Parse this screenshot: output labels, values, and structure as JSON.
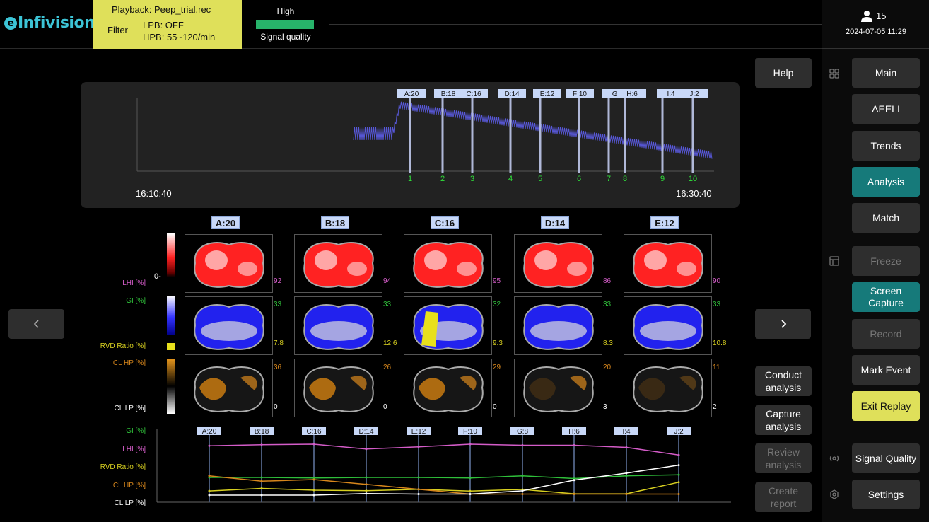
{
  "header": {
    "logo": "Infivision",
    "playback": "Playback:  Peep_trial.rec",
    "filter_label": "Filter",
    "lpb": "LPB: OFF",
    "hpb": "HPB: 55~120/min",
    "signal_level": "High",
    "signal_label": "Signal quality",
    "signal_color": "#27b36a"
  },
  "user": {
    "count": "15",
    "datetime": "2024-07-05 11:29"
  },
  "sidebar": {
    "items": [
      {
        "label": "Main",
        "state": "normal"
      },
      {
        "label": "ΔEELI",
        "state": "normal"
      },
      {
        "label": "Trends",
        "state": "normal"
      },
      {
        "label": "Analysis",
        "state": "active"
      },
      {
        "label": "Match",
        "state": "normal"
      },
      {
        "label": "Freeze",
        "state": "disabled"
      },
      {
        "label": "Screen Capture",
        "state": "active"
      },
      {
        "label": "Record",
        "state": "disabled"
      },
      {
        "label": "Mark Event",
        "state": "normal"
      },
      {
        "label": "Exit Replay",
        "state": "highlight"
      },
      {
        "label": "Signal Quality",
        "state": "normal"
      },
      {
        "label": "Settings",
        "state": "normal"
      }
    ]
  },
  "actions": {
    "help": "Help",
    "conduct": "Conduct analysis",
    "capture": "Capture analysis",
    "review": "Review analysis",
    "create": "Create report"
  },
  "timeline": {
    "start": "16:10:40",
    "end": "16:30:40",
    "markers": [
      {
        "label": "A:20",
        "num": "1"
      },
      {
        "label": "B:18",
        "num": "2"
      },
      {
        "label": "C:16",
        "num": "3"
      },
      {
        "label": "D:14",
        "num": "4"
      },
      {
        "label": "E:12",
        "num": "5"
      },
      {
        "label": "F:10",
        "num": "6"
      },
      {
        "label": "G:",
        "num": "7"
      },
      {
        "label": "H:6",
        "num": "8"
      },
      {
        "label": "I:4",
        "num": "9"
      },
      {
        "label": "J:2",
        "num": "10"
      }
    ]
  },
  "maps": {
    "row_labels": {
      "lhi": "LHI  [%]",
      "gi": "GI   [%]",
      "rvd": "RVD Ratio [%]",
      "clhp": "CL HP [%]",
      "cllp": "CL LP [%]",
      "zero": "0-"
    },
    "columns": [
      {
        "label": "A:20",
        "lhi": "92",
        "gi": "33",
        "rvd": "7.8",
        "clhp": "36",
        "cllp": "0"
      },
      {
        "label": "B:18",
        "lhi": "94",
        "gi": "33",
        "rvd": "12.6",
        "clhp": "26",
        "cllp": "0"
      },
      {
        "label": "C:16",
        "lhi": "95",
        "gi": "32",
        "rvd": "9.3",
        "clhp": "29",
        "cllp": "0"
      },
      {
        "label": "D:14",
        "lhi": "86",
        "gi": "33",
        "rvd": "8.3",
        "clhp": "20",
        "cllp": "3"
      },
      {
        "label": "E:12",
        "lhi": "90",
        "gi": "33",
        "rvd": "10.8",
        "clhp": "11",
        "cllp": "2"
      }
    ]
  },
  "chart_data": {
    "type": "line",
    "categories": [
      "A:20",
      "B:18",
      "C:16",
      "D:14",
      "E:12",
      "F:10",
      "G:8",
      "H:6",
      "I:4",
      "J:2"
    ],
    "series": [
      {
        "name": "GI   [%]",
        "color": "#2fbf3a",
        "values": [
          33,
          33,
          32,
          33,
          33,
          32,
          36,
          31,
          36,
          38
        ]
      },
      {
        "name": "LHI  [%]",
        "color": "#d45cc8",
        "values": [
          92,
          94,
          95,
          86,
          90,
          95,
          93,
          93,
          89,
          75
        ]
      },
      {
        "name": "RVD Ratio [%]",
        "color": "#d8d020",
        "values": [
          7.8,
          12.6,
          9.3,
          8.3,
          10.8,
          7.5,
          10.5,
          2.5,
          2.5,
          24
        ]
      },
      {
        "name": "CL HP [%]",
        "color": "#d8871c",
        "values": [
          36,
          26,
          29,
          20,
          11,
          2,
          2,
          2,
          2,
          2
        ]
      },
      {
        "name": "CL LP [%]",
        "color": "#ffffff",
        "values": [
          0,
          0,
          0,
          3,
          2,
          2,
          8,
          28,
          41,
          56
        ]
      }
    ],
    "legend": "left"
  }
}
